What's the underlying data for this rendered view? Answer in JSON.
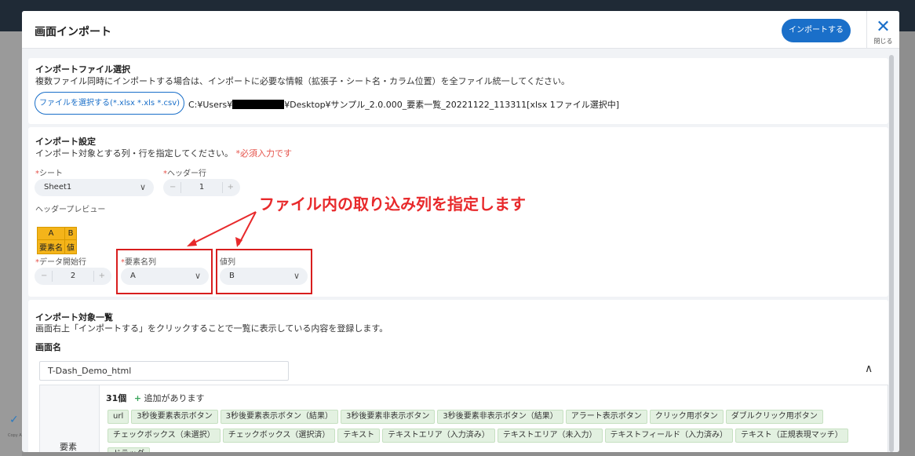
{
  "background": {
    "copyright_text": "Copy\nAll R"
  },
  "modal": {
    "title": "画面インポート",
    "import_button": "インポートする",
    "close_label": "閉じる",
    "close_icon": "✕"
  },
  "file_section": {
    "title": "インポートファイル選択",
    "description": "複数ファイル同時にインポートする場合は、インポートに必要な情報（拡張子・シート名・カラム位置）を全ファイル統一してください。",
    "select_button": "ファイルを選択する(*.xlsx *.xls *.csv)",
    "path_prefix": "C:¥Users¥",
    "path_suffix": "¥Desktop¥サンプル_2.0.000_要素一覧_20221122_113311[xlsx 1ファイル選択中]"
  },
  "settings": {
    "title": "インポート設定",
    "description": "インポート対象とする列・行を指定してください。",
    "required_note": "*必須入力です",
    "required_mark": "*",
    "sheet_label": "シート",
    "sheet_value": "Sheet1",
    "header_row_label": "ヘッダー行",
    "header_row_value": "1",
    "header_preview_label": "ヘッダープレビュー",
    "preview_columns": [
      "A",
      "B"
    ],
    "preview_headers": [
      "要素名",
      "値"
    ],
    "data_start_label": "データ開始行",
    "data_start_value": "2",
    "element_name_col_label": "要素名列",
    "element_name_col_value": "A",
    "value_col_label": "値列",
    "value_col_value": "B",
    "stepper_minus": "−",
    "stepper_plus": "+"
  },
  "annotation": {
    "callout": "ファイル内の取り込み列を指定します",
    "box_color": "#d81e1e"
  },
  "targets": {
    "title": "インポート対象一覧",
    "description": "画面右上「インポートする」をクリックすることで一覧に表示している内容を登録します。",
    "screen_name_label": "画面名",
    "screen_name_value": "T-Dash_Demo_html",
    "elements_label": "要素",
    "count": "31個",
    "added_text": "追加があります",
    "added_icon": "+",
    "tags_row1": [
      "url",
      "3秒後要素表示ボタン",
      "3秒後要素表示ボタン（結果）",
      "3秒後要素非表示ボタン",
      "3秒後要素非表示ボタン（結果）",
      "アラート表示ボタン",
      "クリック用ボタン",
      "ダブルクリック用ボタン"
    ],
    "tags_row2": [
      "チェックボックス（未選択）",
      "チェックボックス（選択済）",
      "テキスト",
      "テキストエリア（入力済み）",
      "テキストエリア（未入力）",
      "テキストフィールド（入力済み）",
      "テキスト（正規表現マッチ）",
      "ドラッグ"
    ]
  },
  "colors": {
    "accent": "#1a6fc9",
    "preview_bg": "#f4b41a",
    "tag_bg": "#e3f1e1",
    "callout": "#e8292b"
  }
}
